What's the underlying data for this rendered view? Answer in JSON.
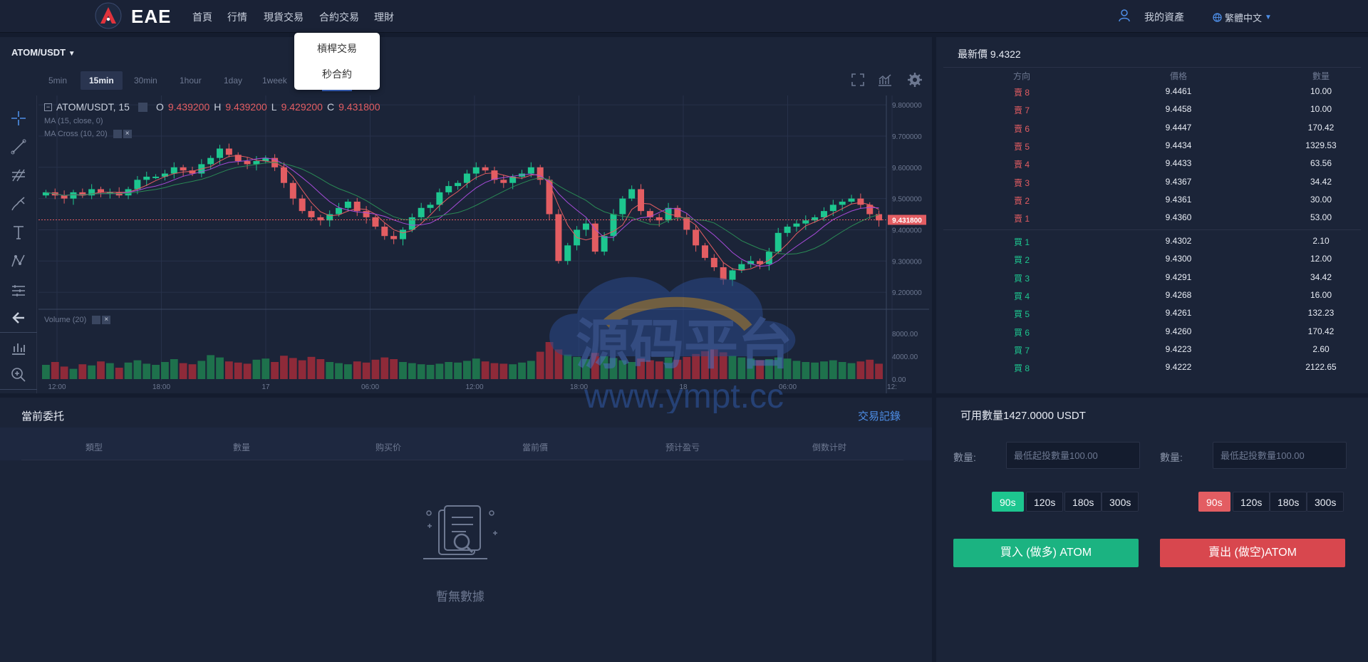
{
  "nav": {
    "brand": "EAE",
    "links": [
      "首頁",
      "行情",
      "現貨交易",
      "合約交易",
      "理財"
    ],
    "assets": "我的資產",
    "language": "繁體中文"
  },
  "dropdown": {
    "items": [
      "槓桿交易",
      "秒合約"
    ]
  },
  "chart": {
    "pair": "ATOM/USDT",
    "timeframes": [
      "5min",
      "15min",
      "30min",
      "1hour",
      "1day",
      "1week"
    ],
    "active_timeframe": "15min",
    "legend_title": "ATOM/USDT, 15",
    "ohlc": {
      "o_label": "O",
      "o": "9.439200",
      "h_label": "H",
      "h": "9.439200",
      "l_label": "L",
      "l": "9.429200",
      "c_label": "C",
      "c": "9.431800"
    },
    "ma_label": "MA (15, close, 0)",
    "macross_label": "MA Cross (10, 20)",
    "volume_label": "Volume (20)",
    "last_price_tag": "9.431800",
    "price_axis": [
      "9.800000",
      "9.700000",
      "9.600000",
      "9.500000",
      "9.400000",
      "9.300000",
      "9.200000"
    ],
    "volume_axis": [
      "8000.00",
      "4000.00",
      "0.00"
    ],
    "time_axis": [
      "12:00",
      "18:00",
      "17",
      "06:00",
      "12:00",
      "18:00",
      "18",
      "06:00",
      "12:"
    ]
  },
  "chart_data": {
    "type": "candlestick",
    "ylim": [
      9.15,
      9.83
    ],
    "last_price": 9.4318,
    "close": [
      9.52,
      9.51,
      9.5,
      9.52,
      9.51,
      9.53,
      9.52,
      9.52,
      9.51,
      9.53,
      9.56,
      9.57,
      9.57,
      9.58,
      9.6,
      9.59,
      9.58,
      9.61,
      9.63,
      9.66,
      9.64,
      9.62,
      9.61,
      9.62,
      9.63,
      9.6,
      9.55,
      9.5,
      9.46,
      9.44,
      9.43,
      9.45,
      9.47,
      9.49,
      9.46,
      9.44,
      9.41,
      9.38,
      9.37,
      9.4,
      9.44,
      9.47,
      9.48,
      9.52,
      9.54,
      9.55,
      9.58,
      9.6,
      9.59,
      9.56,
      9.55,
      9.57,
      9.58,
      9.6,
      9.56,
      9.45,
      9.3,
      9.35,
      9.4,
      9.42,
      9.33,
      9.38,
      9.45,
      9.5,
      9.53,
      9.46,
      9.44,
      9.43,
      9.47,
      9.44,
      9.4,
      9.35,
      9.31,
      9.28,
      9.24,
      9.27,
      9.29,
      9.3,
      9.29,
      9.33,
      9.39,
      9.41,
      9.42,
      9.43,
      9.44,
      9.46,
      9.48,
      9.49,
      9.5,
      9.48,
      9.45,
      9.43
    ],
    "volume": [
      2500,
      3000,
      2200,
      1800,
      2600,
      2400,
      3100,
      2800,
      2000,
      2900,
      3300,
      2700,
      2500,
      3000,
      3500,
      2800,
      2600,
      3200,
      4200,
      3800,
      3100,
      2900,
      2700,
      3400,
      3600,
      3000,
      4100,
      3700,
      3300,
      3900,
      3500,
      3000,
      2800,
      2600,
      3100,
      2900,
      3400,
      3800,
      3500,
      3000,
      2800,
      2600,
      2500,
      2700,
      3000,
      2900,
      3200,
      3600,
      3100,
      2800,
      2700,
      2600,
      2900,
      3200,
      4800,
      6500,
      5200,
      4300,
      3900,
      3500,
      4600,
      4000,
      3700,
      3300,
      3000,
      3600,
      3300,
      3100,
      3800,
      3400,
      3900,
      4400,
      4900,
      5200,
      4700,
      4100,
      3800,
      3600,
      3300,
      3500,
      3800,
      3600,
      3200,
      3000,
      2900,
      3100,
      3300,
      3000,
      2800,
      3100,
      3400,
      2700
    ]
  },
  "orderbook": {
    "last_price_label": "最新價 9.4322",
    "headers": [
      "方向",
      "價格",
      "數量"
    ],
    "sells": [
      {
        "dir": "賣 8",
        "price": "9.4461",
        "qty": "10.00"
      },
      {
        "dir": "賣 7",
        "price": "9.4458",
        "qty": "10.00"
      },
      {
        "dir": "賣 6",
        "price": "9.4447",
        "qty": "170.42"
      },
      {
        "dir": "賣 5",
        "price": "9.4434",
        "qty": "1329.53"
      },
      {
        "dir": "賣 4",
        "price": "9.4433",
        "qty": "63.56"
      },
      {
        "dir": "賣 3",
        "price": "9.4367",
        "qty": "34.42"
      },
      {
        "dir": "賣 2",
        "price": "9.4361",
        "qty": "30.00"
      },
      {
        "dir": "賣 1",
        "price": "9.4360",
        "qty": "53.00"
      }
    ],
    "buys": [
      {
        "dir": "買 1",
        "price": "9.4302",
        "qty": "2.10"
      },
      {
        "dir": "買 2",
        "price": "9.4300",
        "qty": "12.00"
      },
      {
        "dir": "買 3",
        "price": "9.4291",
        "qty": "34.42"
      },
      {
        "dir": "買 4",
        "price": "9.4268",
        "qty": "16.00"
      },
      {
        "dir": "買 5",
        "price": "9.4261",
        "qty": "132.23"
      },
      {
        "dir": "買 6",
        "price": "9.4260",
        "qty": "170.42"
      },
      {
        "dir": "買 7",
        "price": "9.4223",
        "qty": "2.60"
      },
      {
        "dir": "買 8",
        "price": "9.4222",
        "qty": "2122.65"
      }
    ]
  },
  "orders": {
    "title": "當前委托",
    "history_link": "交易記錄",
    "headers": [
      "類型",
      "數量",
      "购买价",
      "當前價",
      "预计盈亏",
      "倒数计时"
    ],
    "empty_text": "暫無數據"
  },
  "trade": {
    "available": "可用數量1427.0000 USDT",
    "qty_label": "數量:",
    "qty_placeholder": "最低起投數量100.00",
    "periods": [
      "90s",
      "120s",
      "180s",
      "300s"
    ],
    "buy_label": "買入 (做多) ATOM",
    "sell_label": "賣出 (做空)ATOM"
  },
  "watermark": {
    "text": "源码平台",
    "url": "www.ympt.cc"
  },
  "colors": {
    "up": "#1dc68f",
    "down": "#e35d62",
    "accent": "#3f6fd8",
    "bg": "#141c2e",
    "panel": "#1b2438"
  }
}
